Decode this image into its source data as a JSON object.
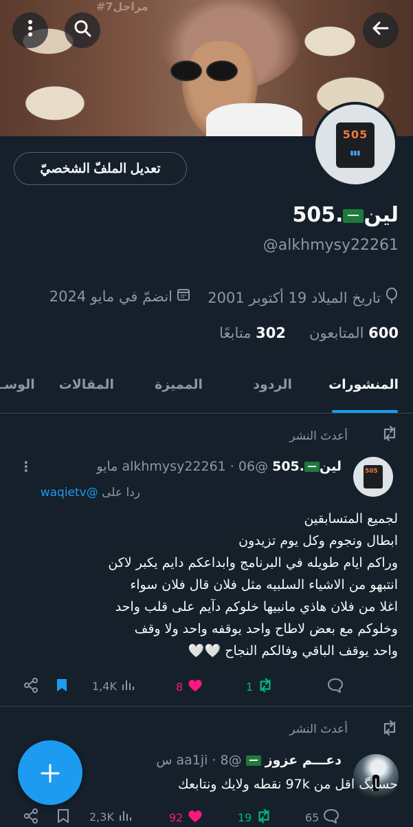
{
  "banner": {
    "watermark": "#مراجل7"
  },
  "top_buttons": {
    "back": "←",
    "search": "search",
    "more": "⋮"
  },
  "profile": {
    "edit_button": "تعديل الملفّ الشخصيّ",
    "name_text": "لين",
    "name_suffix": ".505",
    "handle": "@alkhmysy22261",
    "birth": "تاريخ الميلاد 19 أكتوبر 2001",
    "joined": "انضمّ في مايو 2024",
    "followers_count": "600",
    "followers_label": "المتابعون",
    "following_count": "302",
    "following_label": "متابعًا",
    "avatar_text": "505"
  },
  "tabs": [
    {
      "label": "المنشورات"
    },
    {
      "label": "الردود"
    },
    {
      "label": "المميزة"
    },
    {
      "label": "المقالات"
    },
    {
      "label": "الوسـ"
    }
  ],
  "posts": [
    {
      "repost_label": "أعدتَ النشر",
      "name": "لين",
      "name_suffix": ".505",
      "handle_time": "@alkhmysy22261 · 06 مايو",
      "reply_prefix": "ردا على",
      "reply_to": "@waqietv",
      "lines": [
        "لجميع المتسابقين",
        "ابطال ونجوم وكل يوم تزيدون",
        "وراكم ايام طويله في البرنامج وابداعكم دايم يكبر لاكن",
        "انتبهو من الاشياء السلبيه مثل فلان قال فلان سواء",
        "اغلا من فلان هاذي مانبيها خلوكم دآيم على قلب واحد",
        "وخلوكم مع بعض لاطاح واحد يوقفه واحد ولا وقف",
        "واحد يوقف الباقي وفالكم النجاح 🤍🤍"
      ],
      "replies": "",
      "reposts": "1",
      "likes": "8",
      "views": "1,4K"
    },
    {
      "repost_label": "أعدتَ النشر",
      "name": "دعـــم عزوز",
      "handle_time": "@aa1ji · 8 س",
      "text": "حسابگ اقل من 97k نقطه ولايك ونتابعك",
      "replies": "65",
      "reposts": "19",
      "likes": "92",
      "views": "2,3K"
    }
  ],
  "colors": {
    "bg": "#15202b",
    "accent": "#1d9bf0",
    "like": "#f91880",
    "repost": "#00ba7c",
    "muted": "#8b98a5"
  }
}
